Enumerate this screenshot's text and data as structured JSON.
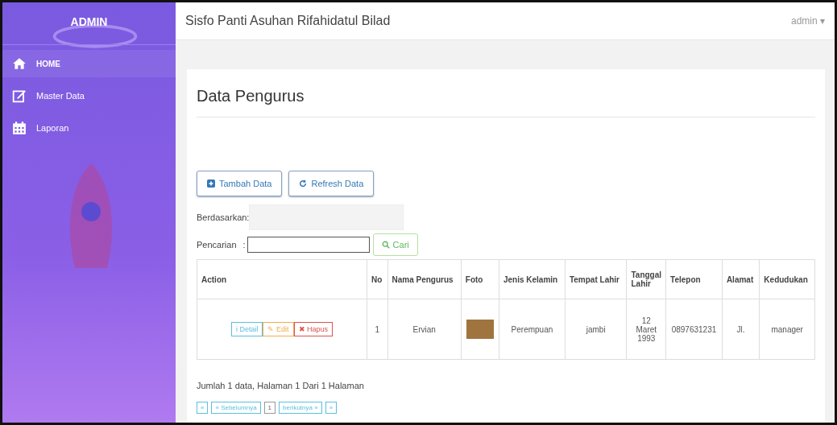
{
  "sidebar": {
    "brand": "ADMIN",
    "items": [
      {
        "label": "HOME",
        "selected": true
      },
      {
        "label": "Master Data",
        "selected": false
      },
      {
        "label": "Laporan",
        "selected": false
      }
    ]
  },
  "topbar": {
    "title": "Sisfo Panti Asuhan Rifahidatul Bilad",
    "user": "admin",
    "caret": "▾"
  },
  "page_title": "Data Pengurus",
  "buttons": [
    {
      "label": "Tambah Data"
    },
    {
      "label": "Refresh Data"
    }
  ],
  "filter": {
    "label": "Berdasarkan:"
  },
  "search": {
    "label": "Pencarian",
    "colon": ":",
    "button": "Cari"
  },
  "table": {
    "columns": [
      "Action",
      "No",
      "Nama Pengurus",
      "Foto",
      "Jenis Kelamin",
      "Tempat Lahir",
      "Tanggal Lahir",
      "Telepon",
      "Alamat",
      "Kedudukan"
    ],
    "rows": [
      {
        "cells": [
          {
            "kind": "actions",
            "buttons": [
              {
                "label": "Detail",
                "kind": "info",
                "icon": "i"
              },
              {
                "label": "Edit",
                "kind": "warning",
                "icon": "✎"
              },
              {
                "label": "Hapus",
                "kind": "danger",
                "icon": "✖"
              }
            ]
          },
          {
            "kind": "text",
            "text": "1"
          },
          {
            "kind": "text",
            "text": "Ervian"
          },
          {
            "kind": "photo"
          },
          {
            "kind": "text",
            "text": "Perempuan"
          },
          {
            "kind": "text",
            "text": "jambi"
          },
          {
            "kind": "text",
            "text": "12 Maret 1993"
          },
          {
            "kind": "text",
            "text": "0897631231"
          },
          {
            "kind": "text",
            "text": "Jl."
          },
          {
            "kind": "text",
            "text": "manager"
          }
        ]
      }
    ]
  },
  "summary": "Jumlah 1 data, Halaman 1 Dari 1 Halaman",
  "pagination": [
    {
      "label": "«",
      "selected": false
    },
    {
      "label": "« Sebelumnya",
      "selected": false
    },
    {
      "label": "1",
      "selected": true
    },
    {
      "label": "berikutnya »",
      "selected": false
    },
    {
      "label": "»",
      "selected": false
    }
  ]
}
